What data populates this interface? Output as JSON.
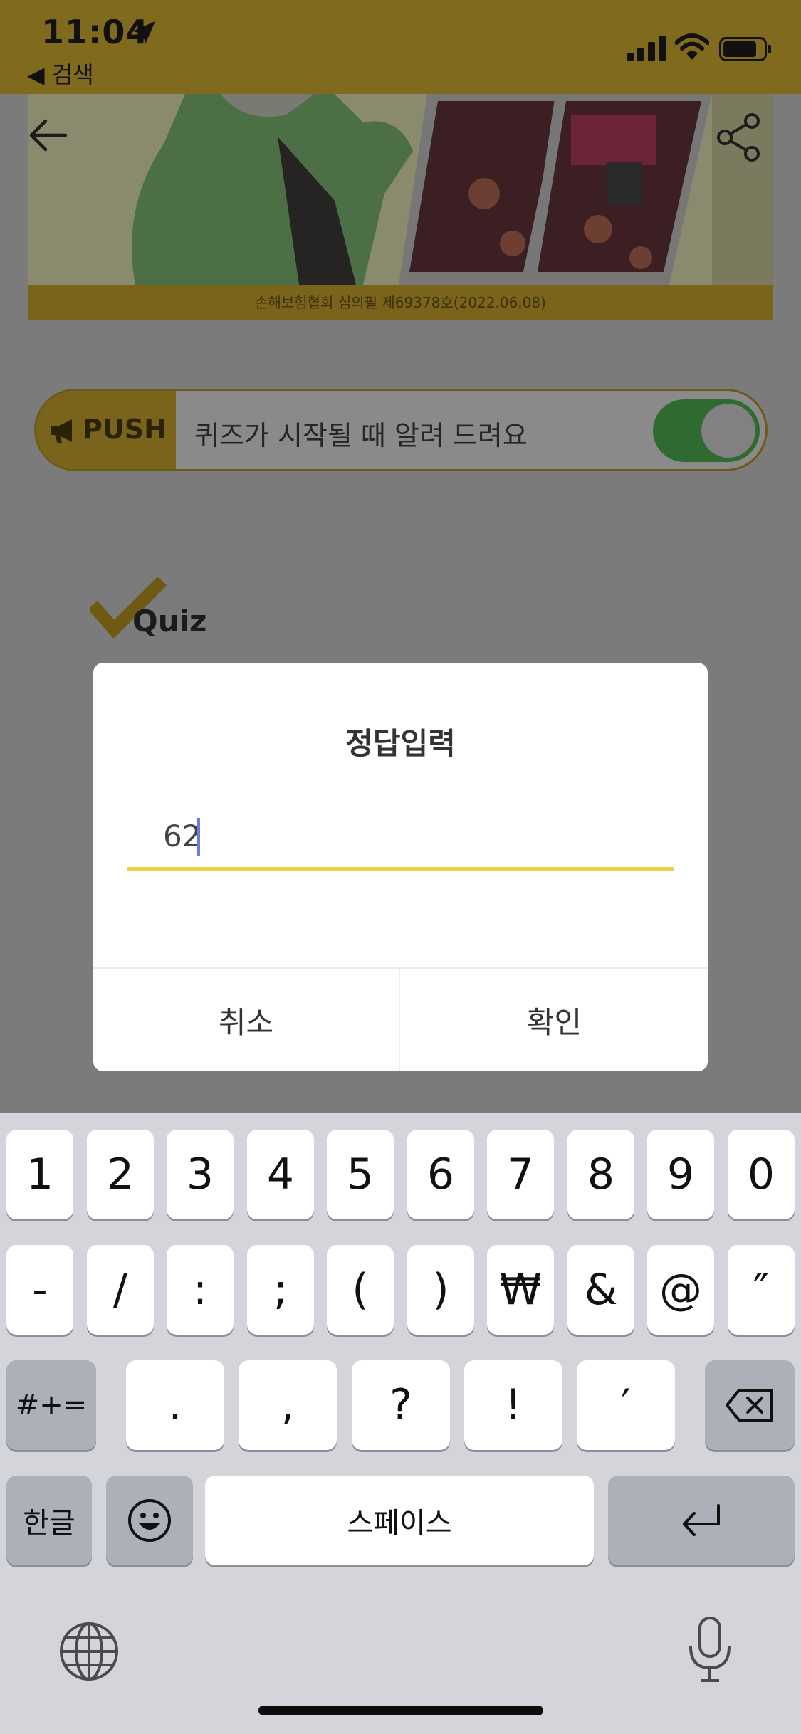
{
  "status_bar": {
    "time": "11:04",
    "back_app": "◀ 검색"
  },
  "banner": {
    "caption": "손해보험협회 심의필 제69378호(2022.06.08)"
  },
  "push": {
    "label": "PUSH",
    "text": "퀴즈가 시작될 때 알려 드려요",
    "toggle_on": true
  },
  "quiz": {
    "label": "Quiz"
  },
  "dialog": {
    "title": "정답입력",
    "input_value": "62",
    "cancel_label": "취소",
    "confirm_label": "확인"
  },
  "keyboard": {
    "row1": [
      "1",
      "2",
      "3",
      "4",
      "5",
      "6",
      "7",
      "8",
      "9",
      "0"
    ],
    "row2": [
      "-",
      "/",
      ":",
      ";",
      "(",
      ")",
      "₩",
      "&",
      "@",
      "″"
    ],
    "row3": {
      "shift": "#+=",
      "keys": [
        ".",
        ",",
        "?",
        "!",
        "′"
      ]
    },
    "row4": {
      "lang": "한글",
      "space": "스페이스"
    }
  },
  "colors": {
    "status_bar": "#806a1e",
    "accent_underline": "#f2cf43",
    "toggle_on": "#2f6b31"
  }
}
